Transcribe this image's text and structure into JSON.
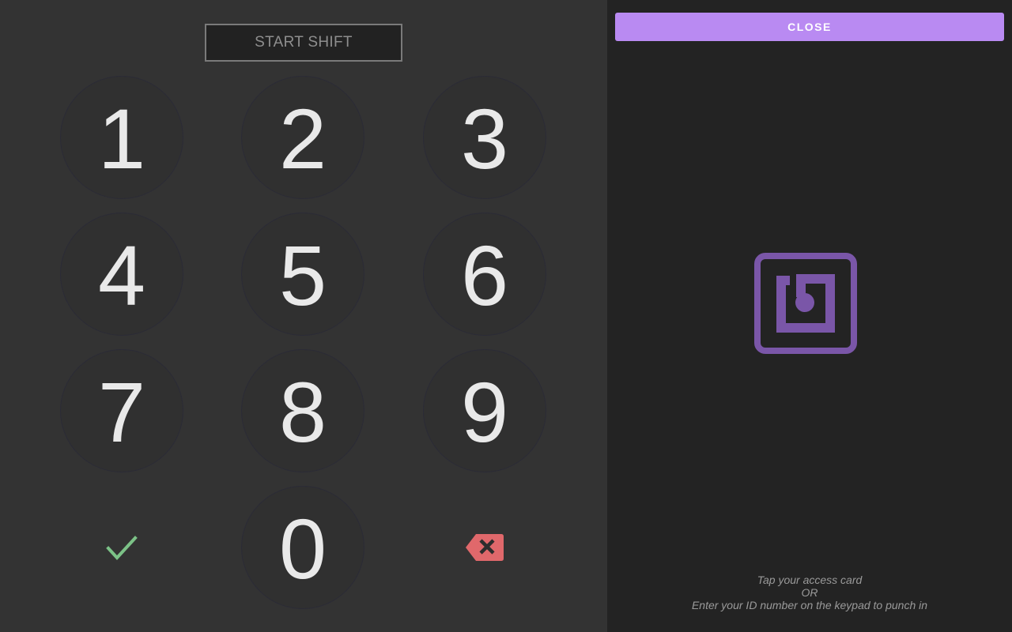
{
  "keypad": {
    "start_shift_label": "START SHIFT",
    "keys": [
      "1",
      "2",
      "3",
      "4",
      "5",
      "6",
      "7",
      "8",
      "9",
      "0"
    ],
    "confirm_icon": "check-icon",
    "backspace_icon": "backspace-icon"
  },
  "right_panel": {
    "close_label": "CLOSE",
    "card_icon": "nfc-icon",
    "instructions": {
      "line1": "Tap your access card",
      "line2": "OR",
      "line3": "Enter your ID number on the keypad to punch in"
    }
  },
  "colors": {
    "accent": "#b98af2",
    "nfc_icon": "#7a56a8",
    "confirm": "#7cc287",
    "backspace": "#e0686b"
  }
}
